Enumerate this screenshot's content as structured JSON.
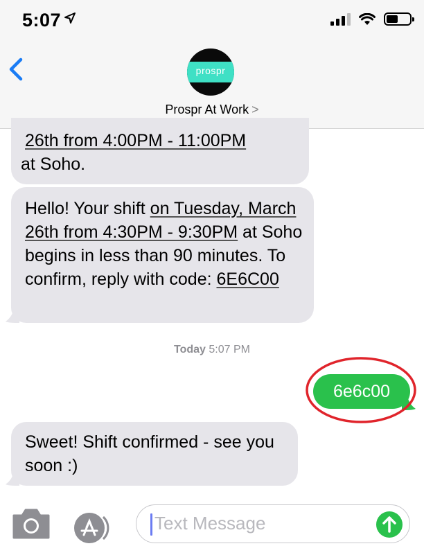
{
  "status": {
    "time": "5:07"
  },
  "header": {
    "avatar_text": "prospr",
    "contact_name": "Prospr At Work",
    "chevron": ">"
  },
  "messages": [
    {
      "direction": "incoming",
      "parts": [
        {
          "text": "26th from 4:00PM - 11:00PM",
          "link": true
        },
        {
          "text": " at Soho.",
          "link": false
        }
      ]
    },
    {
      "direction": "incoming",
      "parts": [
        {
          "text": "Hello! Your shift ",
          "link": false
        },
        {
          "text": "on Tuesday, March 26th from 4:30PM - 9:30PM",
          "link": true
        },
        {
          "text": " at Soho begins in less than 90 minutes. To confirm, reply with code: ",
          "link": false
        },
        {
          "text": "6E6C00",
          "link": true
        }
      ]
    },
    {
      "direction": "outgoing",
      "text": "6e6c00"
    },
    {
      "direction": "incoming",
      "text": "Sweet! Shift confirmed - see you soon :)"
    }
  ],
  "timestamp": {
    "day": "Today",
    "time": "5:07 PM"
  },
  "input": {
    "placeholder": "Text Message"
  },
  "colors": {
    "incoming_bubble": "#e6e5ea",
    "outgoing_bubble": "#2ac14c",
    "accent_blue": "#1a7cf5",
    "annotation_red": "#e0242b",
    "avatar_teal": "#3fe0c5"
  }
}
